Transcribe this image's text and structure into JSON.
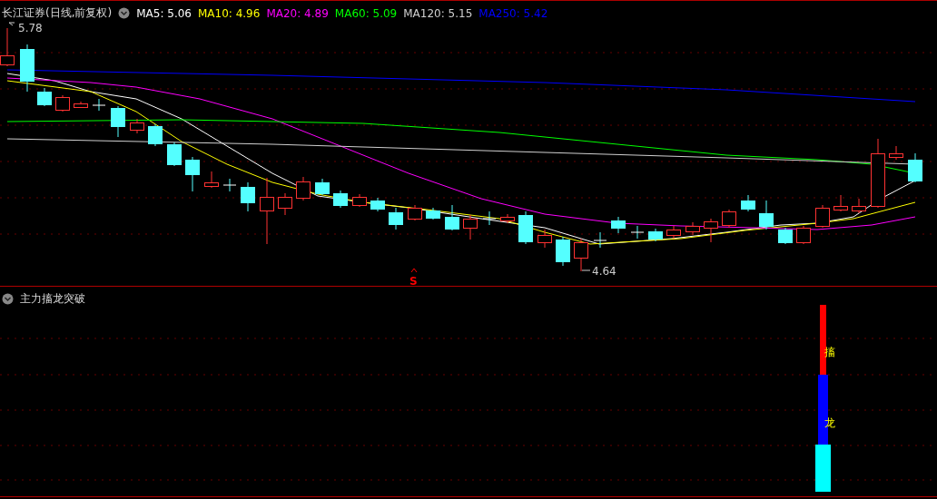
{
  "main_chart": {
    "title": "长江证券(日线,前复权)",
    "moving_averages": [
      {
        "label": "MA5: 5.06",
        "color": "#ffffff"
      },
      {
        "label": "MA10: 4.96",
        "color": "#ffff00"
      },
      {
        "label": "MA20: 4.89",
        "color": "#ff00ff"
      },
      {
        "label": "MA60: 5.09",
        "color": "#00ff00"
      },
      {
        "label": "MA120: 5.15",
        "color": "#d0d0d0"
      },
      {
        "label": "MA250: 5.42",
        "color": "#0000ff"
      }
    ],
    "high_marker": "5.78",
    "low_marker": "4.64",
    "signal_marker": "S"
  },
  "indicator_panel": {
    "title": "主力搐龙突破",
    "bar_labels": [
      "搐",
      "龙"
    ]
  }
}
